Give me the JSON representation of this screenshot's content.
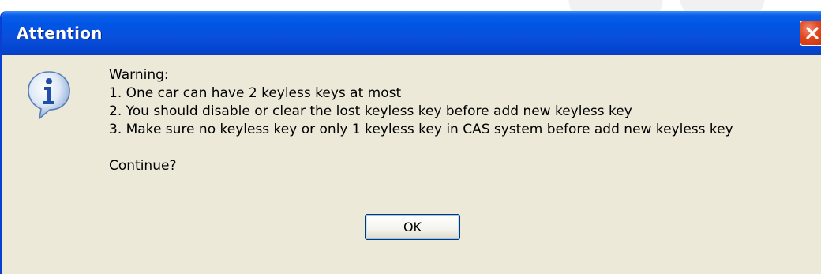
{
  "dialog": {
    "title": "Attention",
    "close_icon": "close-icon",
    "info_icon": "information-icon",
    "message": {
      "line_1": "Warning:",
      "line_2": "1. One car can have 2 keyless keys at most",
      "line_3": "2. You should disable or clear the lost keyless key before add new keyless key",
      "line_4": "3. Make sure no keyless key or only 1 keyless key in CAS system before add new keyless key",
      "line_5": "Continue?"
    },
    "ok_label": "OK"
  },
  "colors": {
    "titlebar": "#0055e5",
    "frame": "#0a3fd3",
    "client_background": "#ece9d8",
    "close_button": "#e0461e"
  }
}
